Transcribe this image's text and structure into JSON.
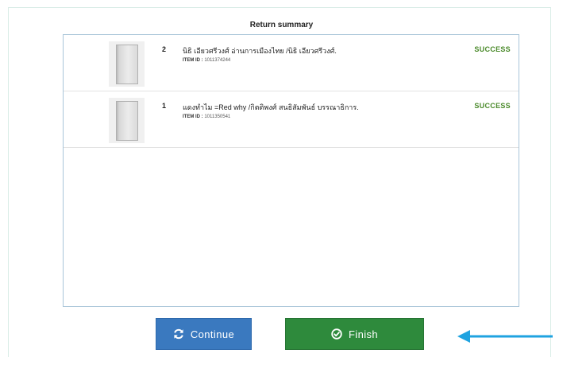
{
  "summary": {
    "title": "Return summary"
  },
  "items": [
    {
      "quantity": "2",
      "title": "นิธิ เอียวศรีวงศ์ อ่านการเมืองไทย /นิธิ เอียวศรีวงศ์.",
      "item_id_label": "ITEM ID :",
      "item_id": "1011374244",
      "status": "SUCCESS",
      "thumbnail_icon": "book-cover-icon"
    },
    {
      "quantity": "1",
      "title": "แดงทำไม =Red why /กิตติพงศ์ สนธิสัมพันธ์ บรรณาธิการ.",
      "item_id_label": "ITEM ID :",
      "item_id": "1011350541",
      "status": "SUCCESS",
      "thumbnail_icon": "book-cover-icon"
    }
  ],
  "buttons": {
    "continue_label": "Continue",
    "continue_icon": "refresh-icon",
    "finish_label": "Finish",
    "finish_icon": "check-circle-icon"
  },
  "colors": {
    "continue": "#3a79bf",
    "finish": "#2e8a3c",
    "status_success": "#4a8a2a",
    "pointer_arrow": "#1fa3e0"
  }
}
